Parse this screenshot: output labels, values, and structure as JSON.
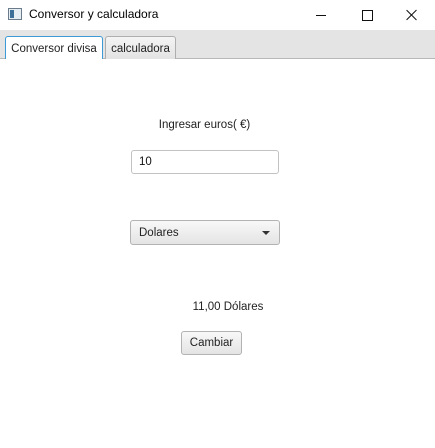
{
  "window": {
    "title": "Conversor y calculadora",
    "icon": "java-app-icon",
    "controls": [
      "minimize-icon",
      "maximize-icon",
      "close-icon"
    ]
  },
  "tabs": [
    {
      "label": "Conversor divisa",
      "selected": true
    },
    {
      "label": "calculadora",
      "selected": false
    }
  ],
  "converter": {
    "euro_label": "Ingresar euros( €)",
    "euro_input_value": "10",
    "currency_selected": "Dolares",
    "result_text": "11,00 Dólares",
    "change_button_label": "Cambiar"
  },
  "colors": {
    "active_tab_border": "#3d9ad6",
    "tab_header_bg": "#e4e4e4"
  }
}
